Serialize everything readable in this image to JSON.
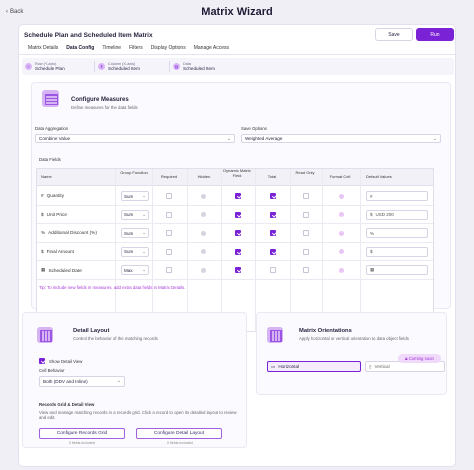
{
  "header": {
    "back_label": "Back",
    "title": "Matrix Wizard"
  },
  "card": {
    "title": "Schedule Plan and Scheduled Item Matrix",
    "save_label": "Save",
    "run_label": "Run",
    "tabs": [
      "Matrix Details",
      "Data Config",
      "Timeline",
      "Filters",
      "Display Options",
      "Manage Access"
    ],
    "info": [
      {
        "label": "Row (Y-axis)",
        "value": "Schedule Plan"
      },
      {
        "label": "Column (X-axis)",
        "value": "Scheduled Item"
      },
      {
        "label": "Data",
        "value": "Scheduled Item"
      }
    ]
  },
  "measures": {
    "title": "Configure Measures",
    "subtitle": "Define measures for the data fields",
    "agg_label": "Data Aggregation",
    "agg_value": "Combine Value",
    "save_label": "Save Options",
    "save_value": "Weighted Average",
    "fields_label": "Data Fields",
    "columns": [
      "Name",
      "Group Function",
      "Required",
      "Hidden",
      "Dynamic Matrix Field",
      "Total",
      "Read Only",
      "Format Cell",
      "Default Values"
    ],
    "rows": [
      {
        "icon": "#",
        "name": "Quantity",
        "fn": "Sum",
        "default": ""
      },
      {
        "icon": "$",
        "name": "Unit Price",
        "fn": "Sum",
        "default": "USD 200"
      },
      {
        "icon": "%",
        "name": "Additional Discount (%)",
        "fn": "Sum",
        "default": "%"
      },
      {
        "icon": "$",
        "name": "Final Amount",
        "fn": "Sum",
        "default": ""
      },
      {
        "icon": "▦",
        "name": "Scheduled Date",
        "fn": "Max",
        "default": ""
      }
    ],
    "tip": "Tip: To include new fields in measures, add extra data fields in Matrix Details."
  },
  "detail": {
    "title": "Detail Layout",
    "subtitle": "Control the behavior of the matching records",
    "show_label": "Show Detail View",
    "cell_label": "Cell Behavior",
    "cell_value": "Both (DDV and Inline)",
    "grid_title": "Records Grid & Detail View",
    "grid_desc": "View and manage matching records in a records grid. Click a record to open its detailed layout to review and edit.",
    "grid_btn": "Configure Records Grid",
    "grid_fields": "0 fields included",
    "layout_btn": "Configure Detail Layout",
    "layout_fields": "0 fields included"
  },
  "orient": {
    "title": "Matrix Orientations",
    "subtitle": "Apply horizontal or vertical orientation to data object fields",
    "soon": "Coming soon",
    "horizontal": "Horizontal",
    "vertical": "Vertical"
  }
}
